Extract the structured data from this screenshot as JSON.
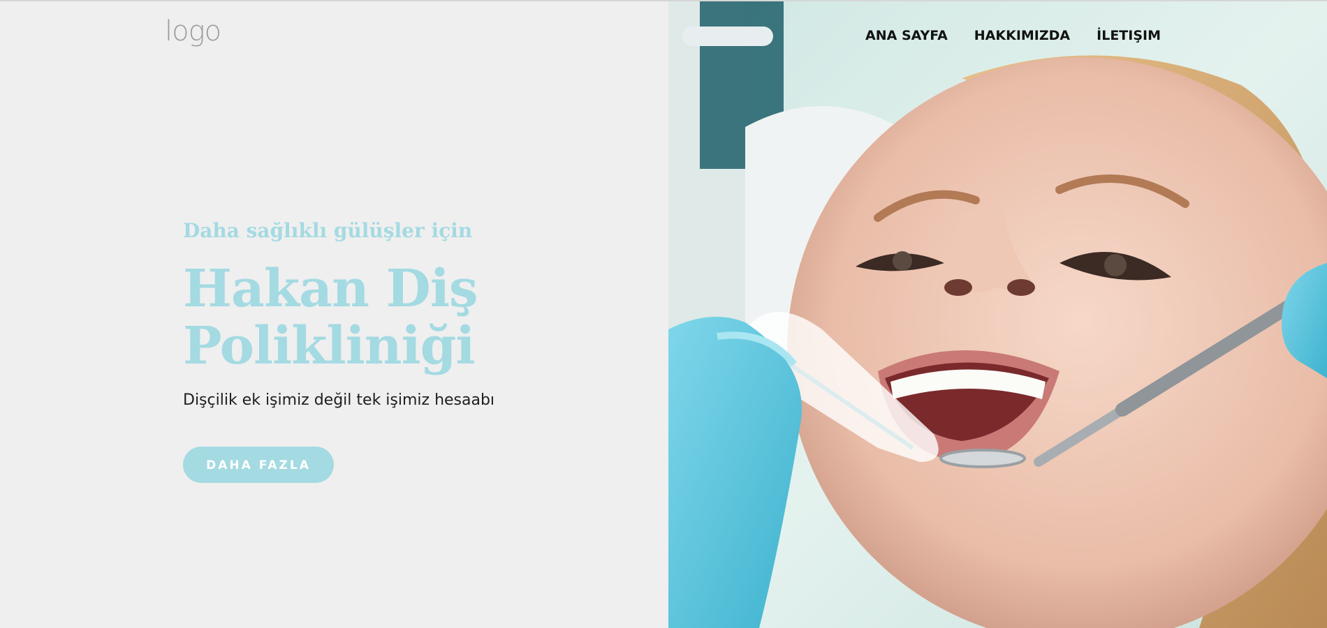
{
  "logo": {
    "text": "logo"
  },
  "nav": {
    "items": [
      {
        "label": "ANA SAYFA"
      },
      {
        "label": "HAKKIMIZDA"
      },
      {
        "label": "İLETIŞIM"
      }
    ]
  },
  "hero": {
    "tagline": "Daha sağlıklı gülüşler için",
    "title_line1": "Hakan Diş",
    "title_line2": "Polikliniği",
    "subtitle": "Dişçilik ek işimiz değil tek işimiz hesaabı",
    "cta_label": "DAHA FAZLA"
  },
  "colors": {
    "accent": "#a4dae2",
    "background": "#efefef",
    "nav_text": "#111111",
    "subtitle_text": "#1e1e1e"
  }
}
